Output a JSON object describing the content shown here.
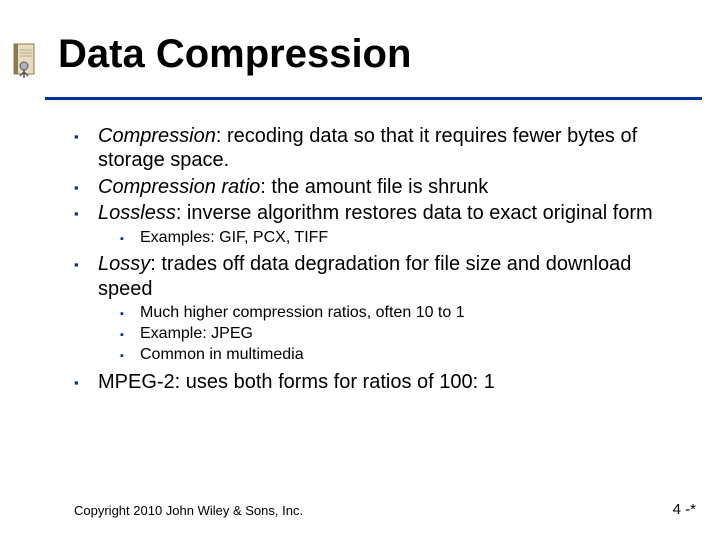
{
  "title": "Data Compression",
  "bullets": {
    "b1_term": "Compression",
    "b1_rest": ":  recoding data so that it requires fewer bytes of storage space.",
    "b2_term": "Compression ratio",
    "b2_rest": ": the amount file is shrunk",
    "b3_term": "Lossless",
    "b3_rest": ": inverse algorithm restores data to exact original form",
    "b3_sub1": "Examples:  GIF, PCX, TIFF",
    "b4_term": "Lossy",
    "b4_rest": ": trades off data degradation for file size and download speed",
    "b4_sub1": "Much higher compression ratios, often 10 to 1",
    "b4_sub2": "Example:  JPEG",
    "b4_sub3": "Common in multimedia",
    "b5": "MPEG-2: uses both forms for ratios of 100: 1"
  },
  "footer": {
    "copyright": "Copyright 2010 John Wiley & Sons, Inc.",
    "page": "4 -*"
  }
}
